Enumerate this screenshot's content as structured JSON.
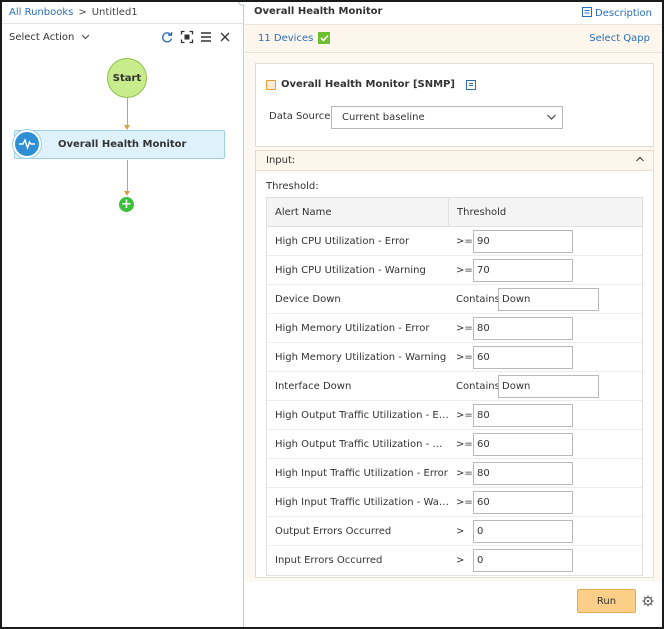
{
  "breadcrumb": {
    "root": "All Runbooks",
    "separator": ">",
    "current": "Untitled1"
  },
  "left_toolbar": {
    "select_action": "Select Action"
  },
  "flow": {
    "start_label": "Start",
    "task_label": "Overall Health Monitor"
  },
  "panel": {
    "title": "Overall Health Monitor",
    "description_link": "Description",
    "devices_link": "11 Devices",
    "select_qapp_link": "Select Qapp",
    "qapp_title": "Overall Health Monitor [SNMP]",
    "data_source_label": "Data Source:",
    "data_source_value": "Current baseline",
    "input_header": "Input:",
    "threshold_label": "Threshold:",
    "table": {
      "col_name": "Alert Name",
      "col_threshold": "Threshold",
      "rows": [
        {
          "name": "High CPU Utilization - Error",
          "op": ">=",
          "value": "90"
        },
        {
          "name": "High CPU Utilization - Warning",
          "op": ">=",
          "value": "70"
        },
        {
          "name": "Device Down",
          "op": "Contains",
          "value": "Down"
        },
        {
          "name": "High Memory Utilization - Error",
          "op": ">=",
          "value": "80"
        },
        {
          "name": "High Memory Utilization - Warning",
          "op": ">=",
          "value": "60"
        },
        {
          "name": "Interface Down",
          "op": "Contains",
          "value": "Down"
        },
        {
          "name": "High Output Traffic Utilization - Error",
          "op": ">=",
          "value": "80"
        },
        {
          "name": "High Output Traffic Utilization - Warn...",
          "op": ">=",
          "value": "60"
        },
        {
          "name": "High Input Traffic Utilization - Error",
          "op": ">=",
          "value": "80"
        },
        {
          "name": "High Input Traffic Utilization - Warning",
          "op": ">=",
          "value": "60"
        },
        {
          "name": "Output Errors Occurred",
          "op": ">",
          "value": "0"
        },
        {
          "name": "Input Errors Occurred",
          "op": ">",
          "value": "0"
        }
      ]
    },
    "run_button": "Run"
  },
  "colors": {
    "accent": "#2a6ebb",
    "start_node": "#c8ec8c",
    "task_node": "#dff1fa",
    "run_button": "#fbcf88",
    "connector": "#d9a04a"
  }
}
